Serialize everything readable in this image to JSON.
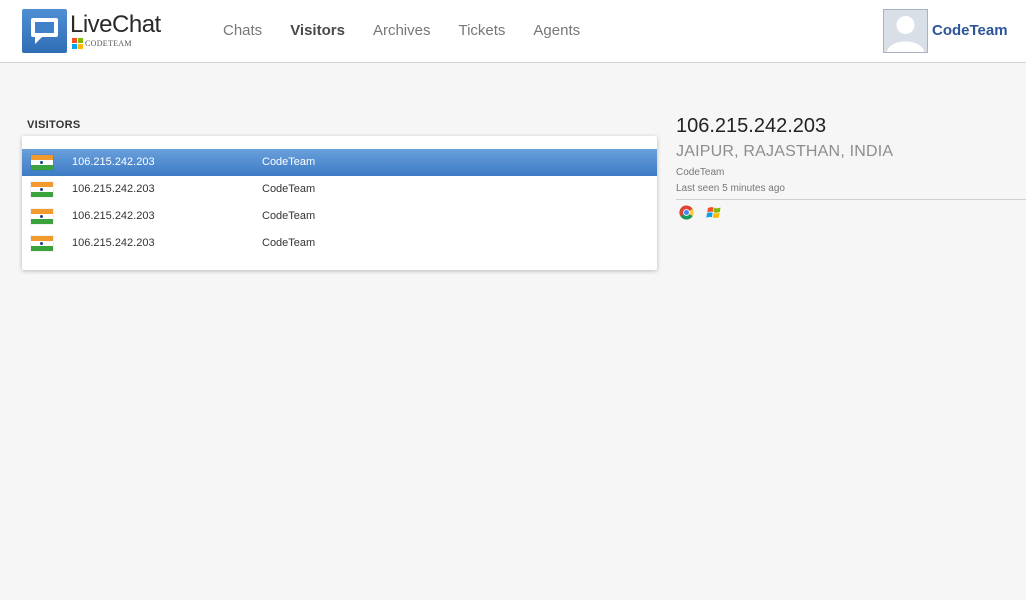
{
  "header": {
    "app_name": "LiveChat",
    "app_sub": "CODETEAM",
    "nav": [
      {
        "label": "Chats",
        "active": false
      },
      {
        "label": "Visitors",
        "active": true
      },
      {
        "label": "Archives",
        "active": false
      },
      {
        "label": "Tickets",
        "active": false
      },
      {
        "label": "Agents",
        "active": false
      }
    ],
    "user_name": "CodeTeam"
  },
  "visitors": {
    "title": "VISITORS",
    "rows": [
      {
        "flag_icon": "india-flag-icon",
        "ip": "106.215.242.203",
        "name": "CodeTeam",
        "selected": true
      },
      {
        "flag_icon": "india-flag-icon",
        "ip": "106.215.242.203",
        "name": "CodeTeam",
        "selected": false
      },
      {
        "flag_icon": "india-flag-icon",
        "ip": "106.215.242.203",
        "name": "CodeTeam",
        "selected": false
      },
      {
        "flag_icon": "india-flag-icon",
        "ip": "106.215.242.203",
        "name": "CodeTeam",
        "selected": false
      }
    ]
  },
  "detail": {
    "ip": "106.215.242.203",
    "location": "JAIPUR, RAJASTHAN, INDIA",
    "name": "CodeTeam",
    "last_seen": "Last seen 5 minutes ago",
    "browser_icon": "chrome-icon",
    "os_icon": "windows-icon"
  },
  "colors": {
    "accent": "#3c7bc5",
    "user_name": "#2d5597",
    "background": "#f6f6f6"
  }
}
